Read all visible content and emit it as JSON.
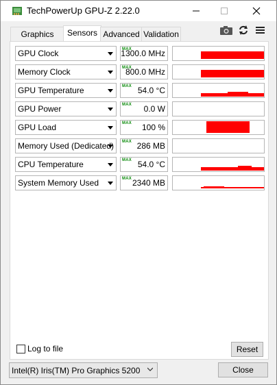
{
  "window": {
    "title": "TechPowerUp GPU-Z 2.22.0"
  },
  "tabs": [
    {
      "label": "Graphics Card"
    },
    {
      "label": "Sensors"
    },
    {
      "label": "Advanced"
    },
    {
      "label": "Validation"
    }
  ],
  "toolbar": {
    "icons": [
      "camera-icon",
      "refresh-icon",
      "menu-icon"
    ]
  },
  "sensors": [
    {
      "name": "GPU Clock",
      "value": "1300.0 MHz",
      "max_tag": "MAX",
      "graph_level": 0.55
    },
    {
      "name": "Memory Clock",
      "value": "800.0 MHz",
      "max_tag": "MAX",
      "graph_level": 0.55
    },
    {
      "name": "GPU Temperature",
      "value": "54.0 °C",
      "max_tag": "MAX",
      "graph_level": 0.3
    },
    {
      "name": "GPU Power",
      "value": "0.0 W",
      "max_tag": "MAX",
      "graph_level": 0
    },
    {
      "name": "GPU Load",
      "value": "100 %",
      "max_tag": "MAX",
      "graph_level": 1.0
    },
    {
      "name": "Memory Used (Dedicated)",
      "value": "286 MB",
      "max_tag": "MAX",
      "graph_level": 0
    },
    {
      "name": "CPU Temperature",
      "value": "54.0 °C",
      "max_tag": "MAX",
      "graph_level": 0.3
    },
    {
      "name": "System Memory Used",
      "value": "2340 MB",
      "max_tag": "MAX",
      "graph_level": 0.1
    }
  ],
  "footer": {
    "log_label": "Log to file",
    "log_checked": false,
    "reset_label": "Reset",
    "device_selected": "Intel(R) Iris(TM) Pro Graphics 5200",
    "close_label": "Close"
  },
  "colors": {
    "graph": "#ff0000",
    "max_tag": "#0a8a0a"
  }
}
